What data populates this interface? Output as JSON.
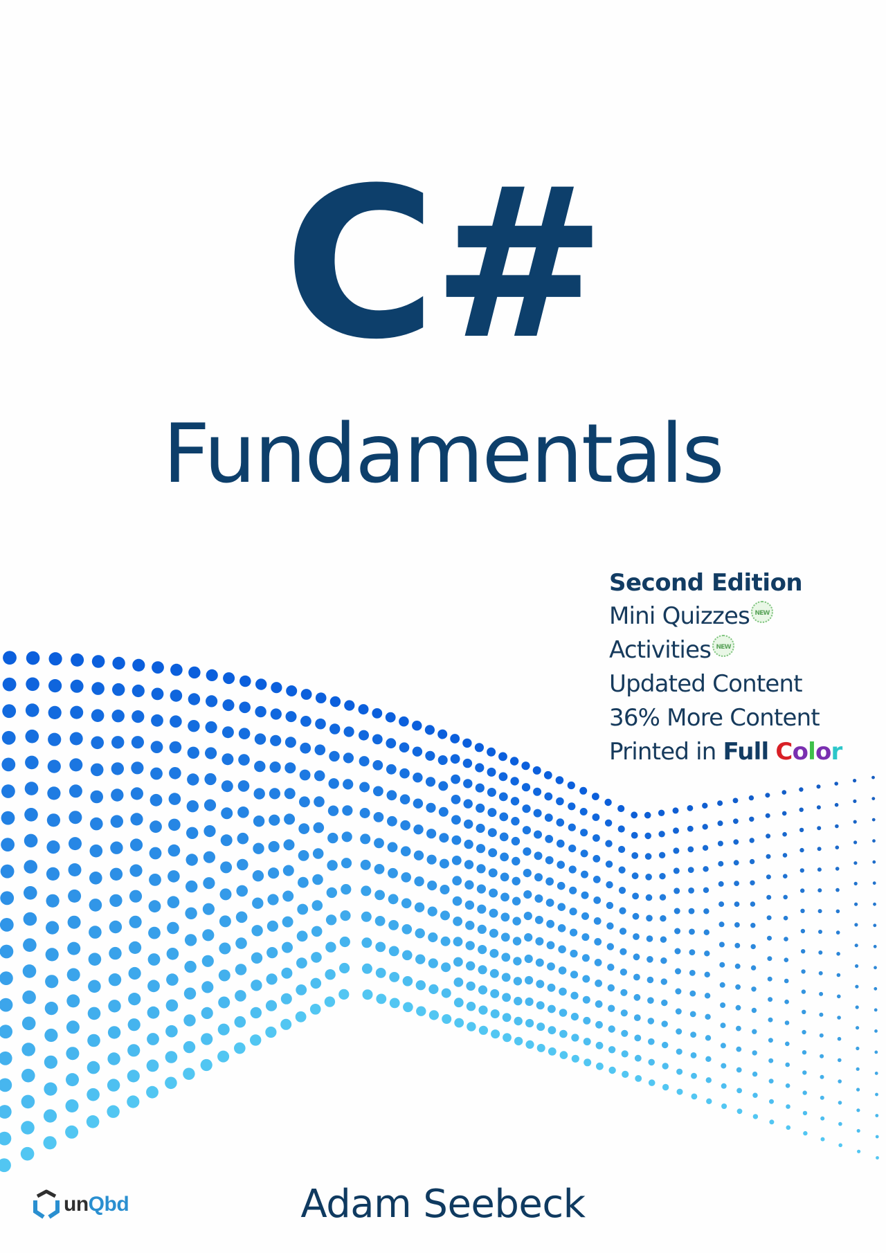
{
  "book": {
    "title_main": "C#",
    "title_sub": "Fundamentals",
    "edition": "Second Edition",
    "features": [
      {
        "label": "Mini Quizzes",
        "badge": "NEW"
      },
      {
        "label": "Activities",
        "badge": "NEW"
      },
      {
        "label": "Updated Content"
      },
      {
        "label": "36% More Content"
      }
    ],
    "printed_prefix": "Printed in ",
    "printed_full": "Full",
    "printed_color_letters": [
      "C",
      "o",
      "l",
      "o",
      "r"
    ],
    "author": "Adam Seebeck"
  },
  "publisher": {
    "name_part1": "un",
    "name_part2": "Qbd"
  },
  "colors": {
    "title": "#0d3f6b",
    "dots_top": "#0b5fdc",
    "dots_bottom": "#52c6f2",
    "badge": "#7cc27c"
  }
}
